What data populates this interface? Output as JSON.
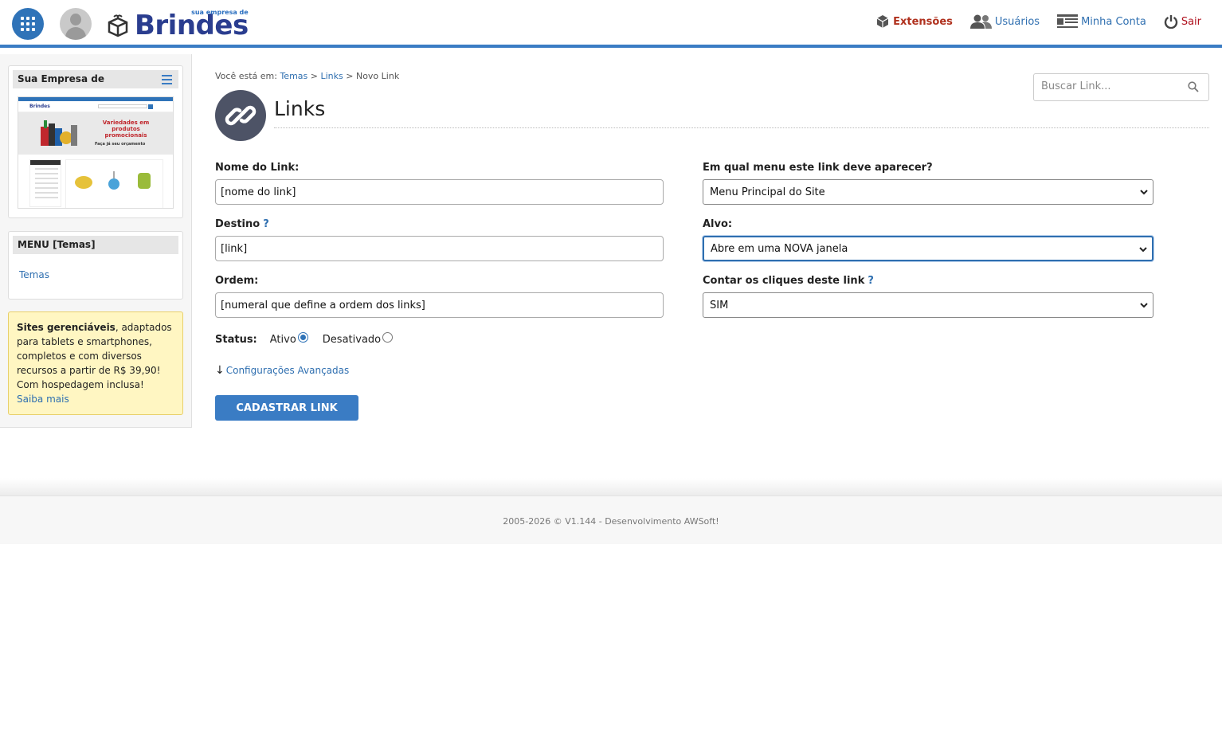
{
  "header": {
    "logo_text": "Brindes",
    "logo_tagline": "sua empresa de",
    "nav": [
      {
        "label": "Extensões",
        "icon": "cube-icon"
      },
      {
        "label": "Usuários",
        "icon": "users-icon"
      },
      {
        "label": "Minha Conta",
        "icon": "account-icon"
      },
      {
        "label": "Sair",
        "icon": "power-icon"
      }
    ]
  },
  "sidebar": {
    "site_panel_title": "Sua Empresa de",
    "site_preview": {
      "banner_text": "Variedades em produtos promocionais",
      "banner_subtext": "Faça já seu orçamento"
    },
    "menu_panel_title": "MENU [Temas]",
    "menu_items": [
      {
        "label": "Temas"
      }
    ],
    "promo": {
      "bold": "Sites gerenciáveis",
      "text": ", adaptados para tablets e smartphones, completos e com diversos recursos a partir de R$ 39,90! Com hospedagem inclusa!",
      "link": "Saiba mais"
    }
  },
  "breadcrumb": {
    "prefix": "Você está em:",
    "items": [
      "Temas",
      "Links"
    ],
    "current": "Novo Link",
    "separator": ">"
  },
  "search": {
    "placeholder": "Buscar Link..."
  },
  "page_title": "Links",
  "form": {
    "name_label": "Nome do Link:",
    "name_value": "[nome do link]",
    "dest_label": "Destino",
    "dest_help": "?",
    "dest_value": "[link]",
    "order_label": "Ordem:",
    "order_value": "[numeral que define a ordem dos links]",
    "menu_label": "Em qual menu este link deve aparecer?",
    "menu_value": "Menu Principal do Site",
    "target_label": "Alvo:",
    "target_value": "Abre em uma NOVA janela",
    "count_label": "Contar os cliques deste link",
    "count_help": "?",
    "count_value": "SIM",
    "status_label": "Status:",
    "status_options": [
      {
        "label": "Ativo",
        "checked": true
      },
      {
        "label": "Desativado",
        "checked": false
      }
    ],
    "advanced_arrow": "↓",
    "advanced_label": "Configurações Avançadas",
    "submit_label": "CADASTRAR LINK"
  },
  "footer": {
    "text": "2005-2026 © V1.144 - Desenvolvimento AWSoft!"
  },
  "colors": {
    "accent": "#3a7cc4",
    "link": "#2f6fb0",
    "exit": "#b0111e",
    "extensions": "#b0311e"
  }
}
